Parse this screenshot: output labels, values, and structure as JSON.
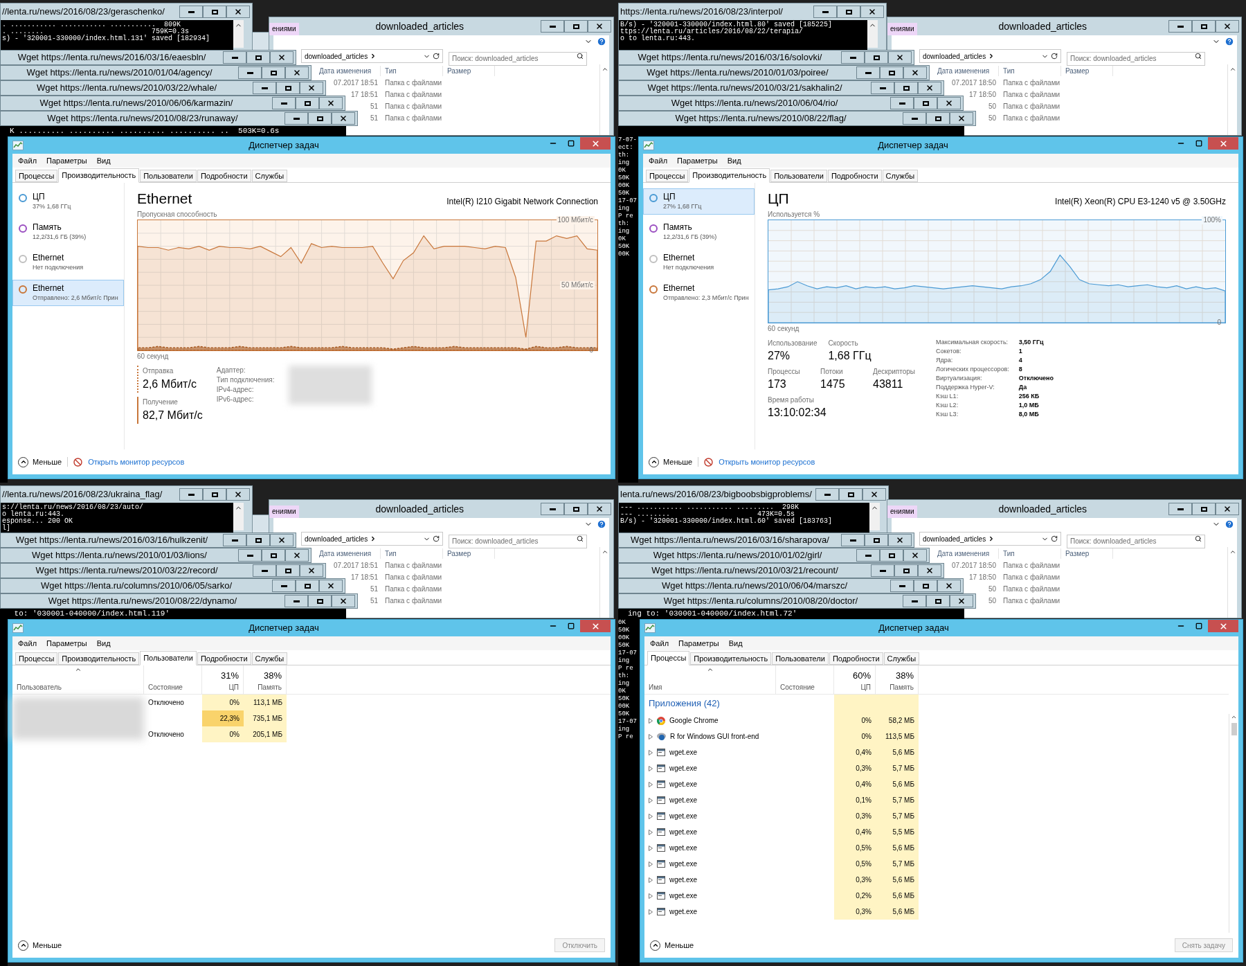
{
  "screens": [
    {
      "console_window": {
        "title": "//lenta.ru/news/2016/08/23/geraschenko/",
        "lines": [
          ". ........... ........... ...........  809K",
          ". ........                          759K=0.3s",
          "s) - '320001-330000/index.html.131' saved [182934]"
        ]
      },
      "explorer": {
        "tab_fragment": "ениями",
        "title": "downloaded_articles",
        "address": "downloaded_articles",
        "search": {
          "placeholder": "Поиск: downloaded_articles"
        },
        "columns": [
          "Дата изменения",
          "Тип",
          "Размер"
        ],
        "rows": [
          {
            "date": "07.2017 18:51",
            "type": "Папка с файлами"
          },
          {
            "date": "17 18:51",
            "type": "Папка с файлами"
          },
          {
            "date": "51",
            "type": "Папка с файлами"
          },
          {
            "date": "51",
            "type": "Папка с файлами"
          }
        ]
      },
      "wget_windows": [
        "Wget https://lenta.ru/news/2016/03/16/eaesbln/",
        "Wget https://lenta.ru/news/2010/01/04/agency/",
        "Wget https://lenta.ru/news/2010/03/22/whale/",
        "Wget https://lenta.ru/news/2010/06/06/karmazin/",
        "Wget https://lenta.ru/news/2010/08/23/runaway/"
      ],
      "bottom_console": "K .......... .......... .......... .......... ..  503K=0.6s",
      "task_manager": {
        "title": "Диспетчер задач",
        "menu": [
          "Файл",
          "Параметры",
          "Вид"
        ],
        "tabs": [
          {
            "label": "Процессы",
            "selected": false
          },
          {
            "label": "Производительность",
            "selected": true
          },
          {
            "label": "Пользователи",
            "selected": false
          },
          {
            "label": "Подробности",
            "selected": false
          },
          {
            "label": "Службы",
            "selected": false
          }
        ],
        "view": {
          "kind": "performance",
          "sidebar": [
            {
              "name": "ЦП",
              "detail": "37% 1,68 ГГц",
              "color": "#4a9ad4",
              "selected": false
            },
            {
              "name": "Память",
              "detail": "12,2/31,6 ГБ (39%)",
              "color": "#9b4fc1",
              "selected": false
            },
            {
              "name": "Ethernet",
              "detail": "Нет подключения",
              "color": "#c0c0c0",
              "selected": false
            },
            {
              "name": "Ethernet",
              "detail": "Отправлено: 2,6 Мбит/с Прин",
              "color": "#c8763a",
              "selected": true
            }
          ],
          "panel": {
            "kind": "network",
            "title": "Ethernet",
            "device": "Intel(R) I210 Gigabit Network Connection",
            "chart_data": {
              "type": "area",
              "title": "Пропускная способность",
              "xlabel": "60 секунд",
              "grid": true,
              "ylim": [
                0,
                100
              ],
              "yticks": [
                {
                  "value": 0,
                  "label": "0"
                },
                {
                  "value": 50,
                  "label": "50 Мбит/с"
                },
                {
                  "value": 100,
                  "label": "100 Мбит/с"
                }
              ],
              "series": [
                {
                  "color": "#c8763a",
                  "values": [
                    80,
                    79,
                    79,
                    77,
                    79,
                    78,
                    80,
                    77,
                    80,
                    79,
                    79,
                    78,
                    80,
                    76,
                    72,
                    79,
                    67,
                    82,
                    79,
                    80,
                    79,
                    79,
                    79,
                    80,
                    67,
                    55,
                    69,
                    75,
                    88,
                    78,
                    80,
                    80,
                    80,
                    79,
                    78,
                    80,
                    79,
                    56,
                    10,
                    84,
                    84,
                    88,
                    86,
                    88,
                    78,
                    77
                  ]
                },
                {
                  "color": "#a85a22",
                  "values": [
                    2,
                    2,
                    3,
                    2,
                    2,
                    2,
                    3,
                    2,
                    2,
                    2,
                    3,
                    2,
                    2,
                    2,
                    2,
                    3,
                    2,
                    2,
                    2,
                    2,
                    3,
                    2,
                    2,
                    2,
                    2,
                    1,
                    2,
                    3,
                    2,
                    2,
                    2,
                    3,
                    2,
                    2,
                    2,
                    2,
                    2,
                    2,
                    1,
                    3,
                    2,
                    2,
                    3,
                    2,
                    2,
                    2
                  ]
                }
              ]
            },
            "rates": [
              {
                "label": "Отправка",
                "value": "2,6 Мбит/с",
                "dotted": true
              },
              {
                "label": "Получение",
                "value": "82,7 Мбит/с",
                "dotted": false
              }
            ],
            "details": [
              "Адаптер:",
              "Тип подключения:",
              "IPv4-адрес:",
              "IPv6-адрес:"
            ],
            "redacted": true
          }
        },
        "footer": {
          "less": "Меньше",
          "link": "Открыть монитор ресурсов"
        }
      }
    },
    {
      "console_window": {
        "title": "https://lenta.ru/news/2016/08/23/interpol/",
        "lines": [
          "B/s) - '320001-330000/index.html.80' saved [185225]",
          "ttps://lenta.ru/articles/2016/08/22/terapia/",
          "o to lenta.ru:443."
        ]
      },
      "explorer": {
        "tab_fragment": "ениями",
        "title": "downloaded_articles",
        "address": "downloaded_articles",
        "search": {
          "placeholder": "Поиск: downloaded_articles"
        },
        "columns": [
          "Дата изменения",
          "Тип",
          "Размер"
        ],
        "rows": [
          {
            "date": "07.2017 18:50",
            "type": "Папка с файлами"
          },
          {
            "date": "17 18:50",
            "type": "Папка с файлами"
          },
          {
            "date": "50",
            "type": "Папка с файлами"
          },
          {
            "date": "50",
            "type": "Папка с файлами"
          }
        ]
      },
      "wget_windows": [
        "Wget https://lenta.ru/news/2016/03/16/solovki/",
        "Wget https://lenta.ru/news/2010/01/03/poiree/",
        "Wget https://lenta.ru/news/2010/03/21/sakhalin2/",
        "Wget https://lenta.ru/news/2010/06/04/rio/",
        "Wget https://lenta.ru/news/2010/08/22/flag/"
      ],
      "side_console": [
        "7-07-",
        "ect:",
        "th:",
        "ing",
        "0K",
        "50K",
        "00K",
        "50K",
        "17-07",
        "ing",
        "P re",
        "th:",
        "ing",
        "0K",
        "50K",
        "00K"
      ],
      "task_manager": {
        "title": "Диспетчер задач",
        "menu": [
          "Файл",
          "Параметры",
          "Вид"
        ],
        "tabs": [
          {
            "label": "Процессы",
            "selected": false
          },
          {
            "label": "Производительность",
            "selected": true
          },
          {
            "label": "Пользователи",
            "selected": false
          },
          {
            "label": "Подробности",
            "selected": false
          },
          {
            "label": "Службы",
            "selected": false
          }
        ],
        "view": {
          "kind": "performance",
          "sidebar": [
            {
              "name": "ЦП",
              "detail": "27% 1,68 ГГц",
              "color": "#4a9ad4",
              "selected": true
            },
            {
              "name": "Память",
              "detail": "12,2/31,6 ГБ (39%)",
              "color": "#9b4fc1",
              "selected": false
            },
            {
              "name": "Ethernet",
              "detail": "Нет подключения",
              "color": "#c0c0c0",
              "selected": false
            },
            {
              "name": "Ethernet",
              "detail": "Отправлено: 2,3 Мбит/с Прин",
              "color": "#c8763a",
              "selected": false
            }
          ],
          "panel": {
            "kind": "cpu",
            "title": "ЦП",
            "device": "Intel(R) Xeon(R) CPU E3-1240 v5 @ 3.50GHz",
            "chart_data": {
              "type": "area",
              "title": "Используется %",
              "xlabel": "60 секунд",
              "grid": true,
              "ylim": [
                0,
                100
              ],
              "yticks": [
                {
                  "value": 0,
                  "label": "0"
                },
                {
                  "value": 100,
                  "label": "100%"
                }
              ],
              "series": [
                {
                  "color": "#4a9ad4",
                  "values": [
                    32,
                    33,
                    35,
                    40,
                    36,
                    33,
                    35,
                    34,
                    36,
                    33,
                    35,
                    34,
                    35,
                    33,
                    34,
                    36,
                    35,
                    34,
                    33,
                    34,
                    35,
                    36,
                    35,
                    34,
                    33,
                    35,
                    36,
                    38,
                    42,
                    50,
                    66,
                    55,
                    42,
                    38,
                    37,
                    36,
                    37,
                    35,
                    36,
                    37,
                    35,
                    34,
                    36,
                    33,
                    35,
                    33,
                    34,
                    31
                  ]
                }
              ]
            },
            "stat_rows": [
              [
                {
                  "label": "Использование",
                  "value": "27%"
                },
                {
                  "label": "Скорость",
                  "value": "1,68 ГГц"
                }
              ],
              [
                {
                  "label": "Процессы",
                  "value": "173"
                },
                {
                  "label": "Потоки",
                  "value": "1475"
                },
                {
                  "label": "Дескрипторы",
                  "value": "43811"
                }
              ],
              [
                {
                  "label": "Время работы",
                  "value": "13:10:02:34"
                }
              ]
            ],
            "details": [
              {
                "label": "Максимальная скорость:",
                "value": "3,50 ГГц"
              },
              {
                "label": "Сокетов:",
                "value": "1"
              },
              {
                "label": "Ядра:",
                "value": "4"
              },
              {
                "label": "Логических процессоров:",
                "value": "8"
              },
              {
                "label": "Виртуализация:",
                "value": "Отключено"
              },
              {
                "label": "Поддержка Hyper-V:",
                "value": "Да"
              },
              {
                "label": "Кэш L1:",
                "value": "256 КБ"
              },
              {
                "label": "Кэш L2:",
                "value": "1,0 МБ"
              },
              {
                "label": "Кэш L3:",
                "value": "8,0 МБ"
              }
            ]
          }
        },
        "footer": {
          "less": "Меньше",
          "link": "Открыть монитор ресурсов"
        }
      }
    },
    {
      "console_window": {
        "title": "//lenta.ru/news/2016/08/23/ukraina_flag/",
        "lines": [
          "s://lenta.ru/news/2016/08/23/auto/",
          "o lenta.ru:443.",
          "esponse... 200 OK",
          "l]"
        ]
      },
      "explorer": {
        "tab_fragment": "ениями",
        "title": "downloaded_articles",
        "address": "downloaded_articles",
        "search": {
          "placeholder": "Поиск: downloaded_articles"
        },
        "columns": [
          "Дата изменения",
          "Тип",
          "Размер"
        ],
        "rows": [
          {
            "date": "07.2017 18:51",
            "type": "Папка с файлами"
          },
          {
            "date": "17 18:51",
            "type": "Папка с файлами"
          },
          {
            "date": "51",
            "type": "Папка с файлами"
          },
          {
            "date": "51",
            "type": "Папка с файлами"
          }
        ]
      },
      "wget_windows": [
        "Wget https://lenta.ru/news/2016/03/16/hulkzenit/",
        "Wget https://lenta.ru/news/2010/01/03/lions/",
        "Wget https://lenta.ru/news/2010/03/22/record/",
        "Wget https://lenta.ru/columns/2010/06/05/sarko/",
        "Wget https://lenta.ru/news/2010/08/22/dynamo/"
      ],
      "bottom_console": " to: '030001-040000/index.html.119'",
      "task_manager": {
        "title": "Диспетчер задач",
        "menu": [
          "Файл",
          "Параметры",
          "Вид"
        ],
        "tabs": [
          {
            "label": "Процессы",
            "selected": false
          },
          {
            "label": "Производительность",
            "selected": false
          },
          {
            "label": "Пользователи",
            "selected": true
          },
          {
            "label": "Подробности",
            "selected": false
          },
          {
            "label": "Службы",
            "selected": false
          }
        ],
        "view": {
          "kind": "users",
          "columns": [
            {
              "label": "Пользователь",
              "sorted": true
            },
            {
              "label": "Состояние",
              "sorted": false
            },
            {
              "percent": "31%",
              "label": "ЦП",
              "sorted": false
            },
            {
              "percent": "38%",
              "label": "Память",
              "sorted": false
            }
          ],
          "redacted": true,
          "rows": [
            {
              "status": "Отключено",
              "cpu": "0%",
              "memory": "113,1 МБ",
              "highlighted": false
            },
            {
              "cpu": "22,3%",
              "memory": "735,1 МБ",
              "highlighted": true
            },
            {
              "status": "Отключено",
              "cpu": "0%",
              "memory": "205,1 МБ",
              "highlighted": false
            }
          ]
        },
        "footer": {
          "less": "Меньше",
          "button": {
            "label": "Отключить",
            "disabled": true
          }
        }
      }
    },
    {
      "console_window": {
        "title": "lenta.ru/news/2016/08/23/bigboobsbigproblems/",
        "lines": [
          "--- ........... ........... .........  298K",
          "--- ........                     473K=0.5s",
          "B/s) - '320001-330000/index.html.60' saved [183763]"
        ]
      },
      "explorer": {
        "tab_fragment": "ениями",
        "title": "downloaded_articles",
        "address": "downloaded_articles",
        "search": {
          "placeholder": "Поиск: downloaded_articles"
        },
        "columns": [
          "Дата изменения",
          "Тип",
          "Размер"
        ],
        "rows": [
          {
            "date": "07.2017 18:50",
            "type": "Папка с файлами"
          },
          {
            "date": "17 18:50",
            "type": "Папка с файлами"
          },
          {
            "date": "50",
            "type": "Папка с файлами"
          },
          {
            "date": "50",
            "type": "Папка с файлами"
          }
        ]
      },
      "wget_windows": [
        "Wget https://lenta.ru/news/2016/03/16/sharapova/",
        "Wget https://lenta.ru/news/2010/01/02/girl/",
        "Wget https://lenta.ru/news/2010/03/21/recount/",
        "Wget https://lenta.ru/news/2010/06/04/marszc/",
        "Wget https://lenta.ru/columns/2010/08/20/doctor/"
      ],
      "bottom_console": "ing to: '030001-040000/index.html.72'",
      "side_console": [
        "0K",
        "50K",
        "00K",
        "50K",
        "17-07",
        "ing",
        "P re",
        "th:",
        "ing",
        "0K",
        "50K",
        "00K",
        "50K",
        "17-07",
        "ing",
        "P re"
      ],
      "task_manager": {
        "title": "Диспетчер задач",
        "menu": [
          "Файл",
          "Параметры",
          "Вид"
        ],
        "tabs": [
          {
            "label": "Процессы",
            "selected": true
          },
          {
            "label": "Производительность",
            "selected": false
          },
          {
            "label": "Пользователи",
            "selected": false
          },
          {
            "label": "Подробности",
            "selected": false
          },
          {
            "label": "Службы",
            "selected": false
          }
        ],
        "view": {
          "kind": "processes",
          "columns": [
            {
              "label": "Имя",
              "sorted": true
            },
            {
              "label": "Состояние",
              "sorted": false
            },
            {
              "percent": "60%",
              "label": "ЦП",
              "sorted": false
            },
            {
              "percent": "38%",
              "label": "Память",
              "sorted": false
            }
          ],
          "group": "Приложения (42)",
          "rows": [
            {
              "kind": "browser",
              "name": "Google Chrome",
              "cpu": "0%",
              "memory": "58,2 МБ"
            },
            {
              "kind": "gui",
              "name": "R for Windows GUI front-end",
              "cpu": "0%",
              "memory": "113,5 МБ"
            },
            {
              "kind": "console",
              "name": "wget.exe",
              "cpu": "0,4%",
              "memory": "5,6 МБ"
            },
            {
              "kind": "console",
              "name": "wget.exe",
              "cpu": "0,3%",
              "memory": "5,7 МБ"
            },
            {
              "kind": "console",
              "name": "wget.exe",
              "cpu": "0,4%",
              "memory": "5,6 МБ"
            },
            {
              "kind": "console",
              "name": "wget.exe",
              "cpu": "0,1%",
              "memory": "5,7 МБ"
            },
            {
              "kind": "console",
              "name": "wget.exe",
              "cpu": "0,3%",
              "memory": "5,7 МБ"
            },
            {
              "kind": "console",
              "name": "wget.exe",
              "cpu": "0,4%",
              "memory": "5,5 МБ"
            },
            {
              "kind": "console",
              "name": "wget.exe",
              "cpu": "0,5%",
              "memory": "5,6 МБ"
            },
            {
              "kind": "console",
              "name": "wget.exe",
              "cpu": "0,5%",
              "memory": "5,7 МБ"
            },
            {
              "kind": "console",
              "name": "wget.exe",
              "cpu": "0,3%",
              "memory": "5,6 МБ"
            },
            {
              "kind": "console",
              "name": "wget.exe",
              "cpu": "0,2%",
              "memory": "5,6 МБ"
            },
            {
              "kind": "console",
              "name": "wget.exe",
              "cpu": "0,3%",
              "memory": "5,6 МБ"
            }
          ]
        },
        "footer": {
          "less": "Меньше",
          "button": {
            "label": "Снять задачу",
            "disabled": true
          }
        }
      }
    }
  ]
}
